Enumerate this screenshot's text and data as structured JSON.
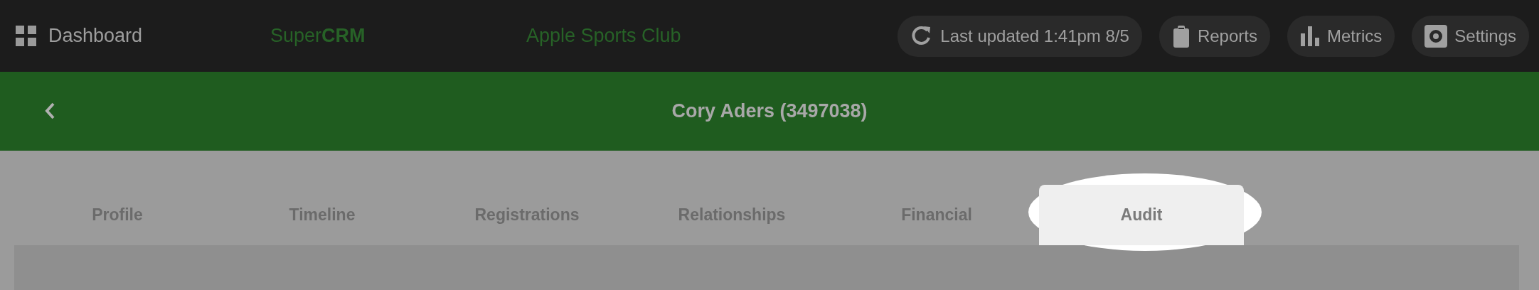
{
  "topbar": {
    "home_label": "Dashboard",
    "brand": "Super**CRM**",
    "organization": "Apple Sports Club",
    "actions": [
      {
        "kind": "refresh",
        "label": "Last updated 1:41pm 8/5"
      },
      {
        "kind": "reports",
        "label": "Reports"
      },
      {
        "kind": "metrics",
        "label": "Metrics"
      },
      {
        "kind": "settings",
        "label": "Settings"
      }
    ]
  },
  "header": {
    "title": "Cory Aders (3497038)"
  },
  "tabs": [
    {
      "label": "Profile",
      "selected": false
    },
    {
      "label": "Timeline",
      "selected": false
    },
    {
      "label": "Registrations",
      "selected": false
    },
    {
      "label": "Relationships",
      "selected": false
    },
    {
      "label": "Financial",
      "selected": false
    },
    {
      "label": "Audit",
      "selected": true
    }
  ]
}
